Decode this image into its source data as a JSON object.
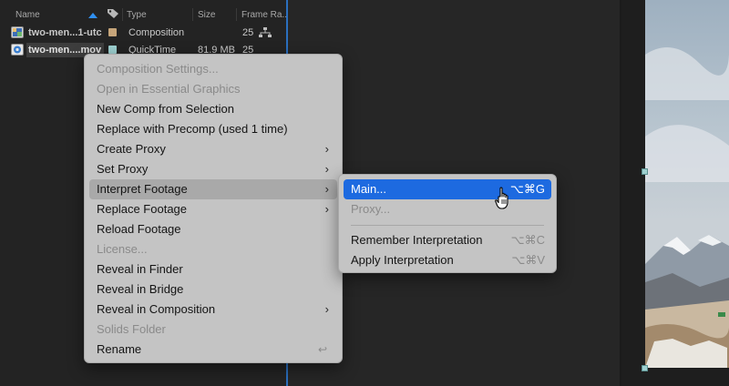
{
  "project_panel": {
    "columns": {
      "name": "Name",
      "type": "Type",
      "size": "Size",
      "frame_rate": "Frame Ra..."
    },
    "rows": [
      {
        "name": "two-men...1-utc",
        "type": "Composition",
        "size": "",
        "fps": "25",
        "icon": "composition-icon",
        "label_color": "#c6a57a"
      },
      {
        "name": "two-men....mov",
        "type": "QuickTime",
        "size": "81.9 MB",
        "fps": "25",
        "icon": "quicktime-icon",
        "label_color": "#9ccfcf"
      }
    ]
  },
  "context_menu": {
    "items": [
      {
        "label": "Composition Settings...",
        "disabled": true
      },
      {
        "label": "Open in Essential Graphics",
        "disabled": true
      },
      {
        "label": "New Comp from Selection"
      },
      {
        "label": "Replace with Precomp (used 1 time)"
      },
      {
        "label": "Create Proxy",
        "submenu": true
      },
      {
        "label": "Set Proxy",
        "submenu": true
      },
      {
        "label": "Interpret Footage",
        "submenu": true,
        "hovered": true
      },
      {
        "label": "Replace Footage",
        "submenu": true
      },
      {
        "label": "Reload Footage"
      },
      {
        "label": "License...",
        "disabled": true
      },
      {
        "label": "Reveal in Finder"
      },
      {
        "label": "Reveal in Bridge"
      },
      {
        "label": "Reveal in Composition",
        "submenu": true
      },
      {
        "label": "Solids Folder",
        "disabled": true
      },
      {
        "label": "Rename",
        "enter_glyph": "↩"
      }
    ],
    "chevron": "›"
  },
  "submenu": {
    "items": [
      {
        "label": "Main...",
        "shortcut": "⌥⌘G",
        "selected": true
      },
      {
        "label": "Proxy...",
        "shortcut": "",
        "disabled": true
      },
      {
        "label": "Remember Interpretation",
        "shortcut": "⌥⌘C"
      },
      {
        "label": "Apply Interpretation",
        "shortcut": "⌥⌘V"
      }
    ]
  },
  "colors": {
    "accent": "#1d6ae0",
    "panel_border": "#2b6fbf"
  }
}
